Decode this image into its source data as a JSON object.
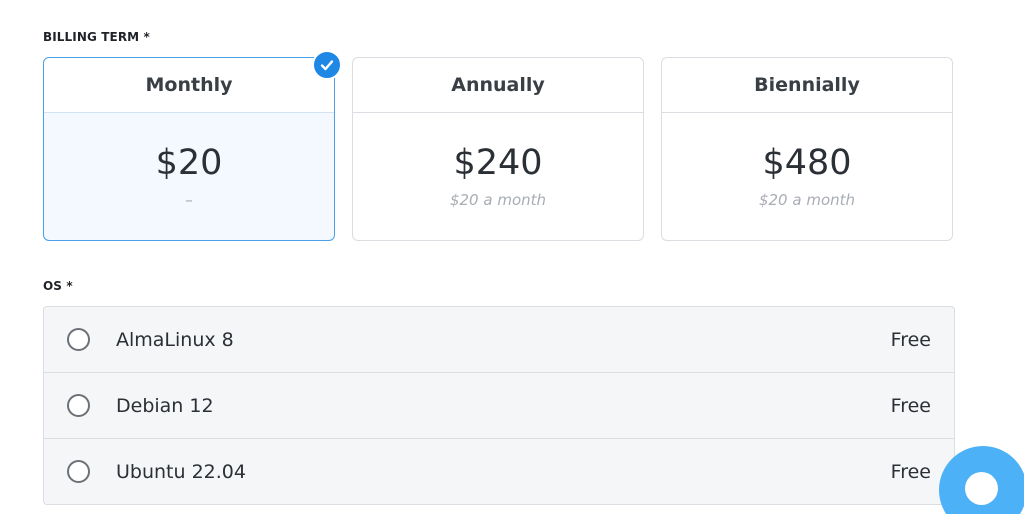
{
  "billing": {
    "label": "BILLING TERM *",
    "terms": [
      {
        "name": "Monthly",
        "price": "$20",
        "sub": "–",
        "selected": true
      },
      {
        "name": "Annually",
        "price": "$240",
        "sub": "$20 a month",
        "selected": false
      },
      {
        "name": "Biennially",
        "price": "$480",
        "sub": "$20 a month",
        "selected": false
      }
    ]
  },
  "os": {
    "label": "OS *",
    "options": [
      {
        "name": "AlmaLinux 8",
        "price": "Free"
      },
      {
        "name": "Debian 12",
        "price": "Free"
      },
      {
        "name": "Ubuntu 22.04",
        "price": "Free"
      }
    ]
  },
  "icons": {
    "check": "checkmark-icon",
    "chat": "chat-icon"
  },
  "colors": {
    "accent": "#1f88e5",
    "selected_bg": "#f3f9ff",
    "selected_border": "#4a9fe6",
    "chat_bubble": "#4cb1f7"
  }
}
